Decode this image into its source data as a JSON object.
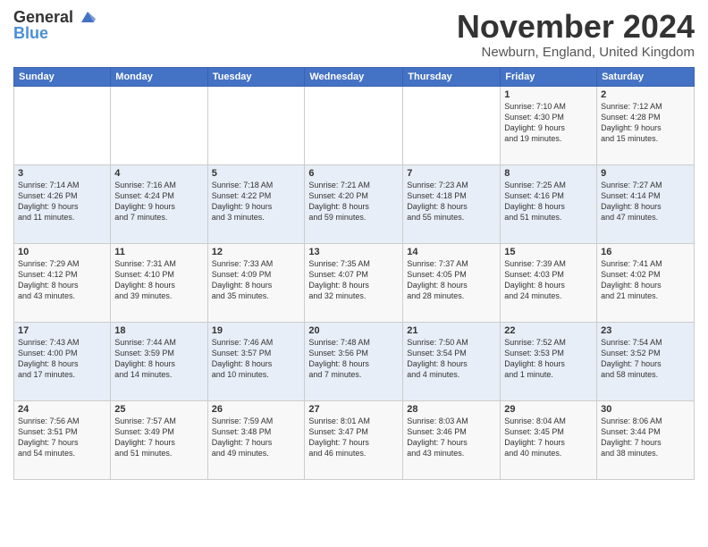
{
  "header": {
    "logo_line1": "General",
    "logo_line2": "Blue",
    "month_title": "November 2024",
    "location": "Newburn, England, United Kingdom"
  },
  "days_of_week": [
    "Sunday",
    "Monday",
    "Tuesday",
    "Wednesday",
    "Thursday",
    "Friday",
    "Saturday"
  ],
  "weeks": [
    [
      {
        "num": "",
        "info": ""
      },
      {
        "num": "",
        "info": ""
      },
      {
        "num": "",
        "info": ""
      },
      {
        "num": "",
        "info": ""
      },
      {
        "num": "",
        "info": ""
      },
      {
        "num": "1",
        "info": "Sunrise: 7:10 AM\nSunset: 4:30 PM\nDaylight: 9 hours\nand 19 minutes."
      },
      {
        "num": "2",
        "info": "Sunrise: 7:12 AM\nSunset: 4:28 PM\nDaylight: 9 hours\nand 15 minutes."
      }
    ],
    [
      {
        "num": "3",
        "info": "Sunrise: 7:14 AM\nSunset: 4:26 PM\nDaylight: 9 hours\nand 11 minutes."
      },
      {
        "num": "4",
        "info": "Sunrise: 7:16 AM\nSunset: 4:24 PM\nDaylight: 9 hours\nand 7 minutes."
      },
      {
        "num": "5",
        "info": "Sunrise: 7:18 AM\nSunset: 4:22 PM\nDaylight: 9 hours\nand 3 minutes."
      },
      {
        "num": "6",
        "info": "Sunrise: 7:21 AM\nSunset: 4:20 PM\nDaylight: 8 hours\nand 59 minutes."
      },
      {
        "num": "7",
        "info": "Sunrise: 7:23 AM\nSunset: 4:18 PM\nDaylight: 8 hours\nand 55 minutes."
      },
      {
        "num": "8",
        "info": "Sunrise: 7:25 AM\nSunset: 4:16 PM\nDaylight: 8 hours\nand 51 minutes."
      },
      {
        "num": "9",
        "info": "Sunrise: 7:27 AM\nSunset: 4:14 PM\nDaylight: 8 hours\nand 47 minutes."
      }
    ],
    [
      {
        "num": "10",
        "info": "Sunrise: 7:29 AM\nSunset: 4:12 PM\nDaylight: 8 hours\nand 43 minutes."
      },
      {
        "num": "11",
        "info": "Sunrise: 7:31 AM\nSunset: 4:10 PM\nDaylight: 8 hours\nand 39 minutes."
      },
      {
        "num": "12",
        "info": "Sunrise: 7:33 AM\nSunset: 4:09 PM\nDaylight: 8 hours\nand 35 minutes."
      },
      {
        "num": "13",
        "info": "Sunrise: 7:35 AM\nSunset: 4:07 PM\nDaylight: 8 hours\nand 32 minutes."
      },
      {
        "num": "14",
        "info": "Sunrise: 7:37 AM\nSunset: 4:05 PM\nDaylight: 8 hours\nand 28 minutes."
      },
      {
        "num": "15",
        "info": "Sunrise: 7:39 AM\nSunset: 4:03 PM\nDaylight: 8 hours\nand 24 minutes."
      },
      {
        "num": "16",
        "info": "Sunrise: 7:41 AM\nSunset: 4:02 PM\nDaylight: 8 hours\nand 21 minutes."
      }
    ],
    [
      {
        "num": "17",
        "info": "Sunrise: 7:43 AM\nSunset: 4:00 PM\nDaylight: 8 hours\nand 17 minutes."
      },
      {
        "num": "18",
        "info": "Sunrise: 7:44 AM\nSunset: 3:59 PM\nDaylight: 8 hours\nand 14 minutes."
      },
      {
        "num": "19",
        "info": "Sunrise: 7:46 AM\nSunset: 3:57 PM\nDaylight: 8 hours\nand 10 minutes."
      },
      {
        "num": "20",
        "info": "Sunrise: 7:48 AM\nSunset: 3:56 PM\nDaylight: 8 hours\nand 7 minutes."
      },
      {
        "num": "21",
        "info": "Sunrise: 7:50 AM\nSunset: 3:54 PM\nDaylight: 8 hours\nand 4 minutes."
      },
      {
        "num": "22",
        "info": "Sunrise: 7:52 AM\nSunset: 3:53 PM\nDaylight: 8 hours\nand 1 minute."
      },
      {
        "num": "23",
        "info": "Sunrise: 7:54 AM\nSunset: 3:52 PM\nDaylight: 7 hours\nand 58 minutes."
      }
    ],
    [
      {
        "num": "24",
        "info": "Sunrise: 7:56 AM\nSunset: 3:51 PM\nDaylight: 7 hours\nand 54 minutes."
      },
      {
        "num": "25",
        "info": "Sunrise: 7:57 AM\nSunset: 3:49 PM\nDaylight: 7 hours\nand 51 minutes."
      },
      {
        "num": "26",
        "info": "Sunrise: 7:59 AM\nSunset: 3:48 PM\nDaylight: 7 hours\nand 49 minutes."
      },
      {
        "num": "27",
        "info": "Sunrise: 8:01 AM\nSunset: 3:47 PM\nDaylight: 7 hours\nand 46 minutes."
      },
      {
        "num": "28",
        "info": "Sunrise: 8:03 AM\nSunset: 3:46 PM\nDaylight: 7 hours\nand 43 minutes."
      },
      {
        "num": "29",
        "info": "Sunrise: 8:04 AM\nSunset: 3:45 PM\nDaylight: 7 hours\nand 40 minutes."
      },
      {
        "num": "30",
        "info": "Sunrise: 8:06 AM\nSunset: 3:44 PM\nDaylight: 7 hours\nand 38 minutes."
      }
    ]
  ]
}
